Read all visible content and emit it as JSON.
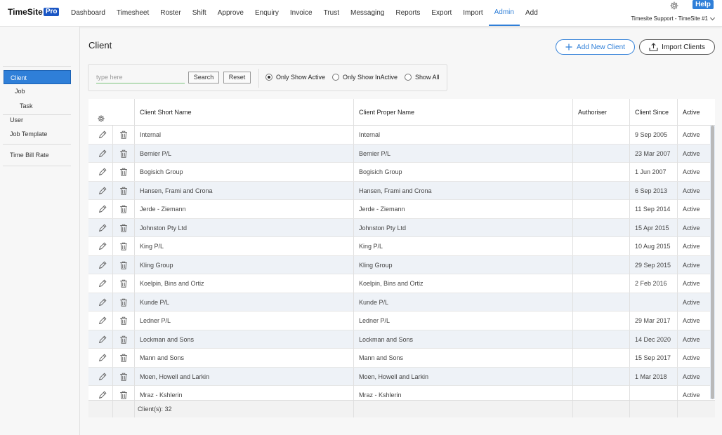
{
  "app": {
    "logo_text": "TimeSite",
    "logo_badge": "Pro",
    "nav": [
      "Dashboard",
      "Timesheet",
      "Roster",
      "Shift",
      "Approve",
      "Enquiry",
      "Invoice",
      "Trust",
      "Messaging",
      "Reports",
      "Export",
      "Import",
      "Admin",
      "Add"
    ],
    "active_nav": "Admin",
    "help_label": "Help",
    "site_label": "Timesite Support - TimeSite #1"
  },
  "sidebar": {
    "items": [
      {
        "label": "Client",
        "active": true
      },
      {
        "label": "Job"
      },
      {
        "label": "Task"
      },
      {
        "label": "User"
      },
      {
        "label": "Job Template"
      },
      {
        "label": "Time Bill Rate"
      }
    ]
  },
  "page": {
    "title": "Client",
    "add_button": "Add New Client",
    "import_button": "Import Clients"
  },
  "filter": {
    "search_placeholder": "type here",
    "search_value": "",
    "search_button": "Search",
    "reset_button": "Reset",
    "options": [
      {
        "label": "Only Show Active",
        "checked": true
      },
      {
        "label": "Only Show InActive",
        "checked": false
      },
      {
        "label": "Show All",
        "checked": false
      }
    ]
  },
  "table": {
    "columns": [
      "Client Short Name",
      "Client Proper Name",
      "Authoriser",
      "Client Since",
      "Active"
    ],
    "rows": [
      [
        "Internal",
        "Internal",
        "",
        "9 Sep 2005",
        "Active"
      ],
      [
        "Bernier P/L",
        "Bernier P/L",
        "",
        "23 Mar 2007",
        "Active"
      ],
      [
        "Bogisich Group",
        "Bogisich Group",
        "",
        "1 Jun 2007",
        "Active"
      ],
      [
        "Hansen, Frami and Crona",
        "Hansen, Frami and Crona",
        "",
        "6 Sep 2013",
        "Active"
      ],
      [
        "Jerde - Ziemann",
        "Jerde - Ziemann",
        "",
        "11 Sep 2014",
        "Active"
      ],
      [
        "Johnston Pty Ltd",
        "Johnston Pty Ltd",
        "",
        "15 Apr 2015",
        "Active"
      ],
      [
        "King P/L",
        "King P/L",
        "",
        "10 Aug 2015",
        "Active"
      ],
      [
        "Kling Group",
        "Kling Group",
        "",
        "29 Sep 2015",
        "Active"
      ],
      [
        "Koelpin, Bins and Ortiz",
        "Koelpin, Bins and Ortiz",
        "",
        "2 Feb 2016",
        "Active"
      ],
      [
        "Kunde P/L",
        "Kunde P/L",
        "",
        "",
        "Active"
      ],
      [
        "Ledner P/L",
        "Ledner P/L",
        "",
        "29 Mar 2017",
        "Active"
      ],
      [
        "Lockman and Sons",
        "Lockman and Sons",
        "",
        "14 Dec 2020",
        "Active"
      ],
      [
        "Mann and Sons",
        "Mann and Sons",
        "",
        "15 Sep 2017",
        "Active"
      ],
      [
        "Moen, Howell and Larkin",
        "Moen, Howell and Larkin",
        "",
        "1 Mar 2018",
        "Active"
      ],
      [
        "Mraz - Kshlerin",
        "Mraz - Kshlerin",
        "",
        "",
        "Active"
      ]
    ],
    "footer_count": "Client(s): 32"
  }
}
